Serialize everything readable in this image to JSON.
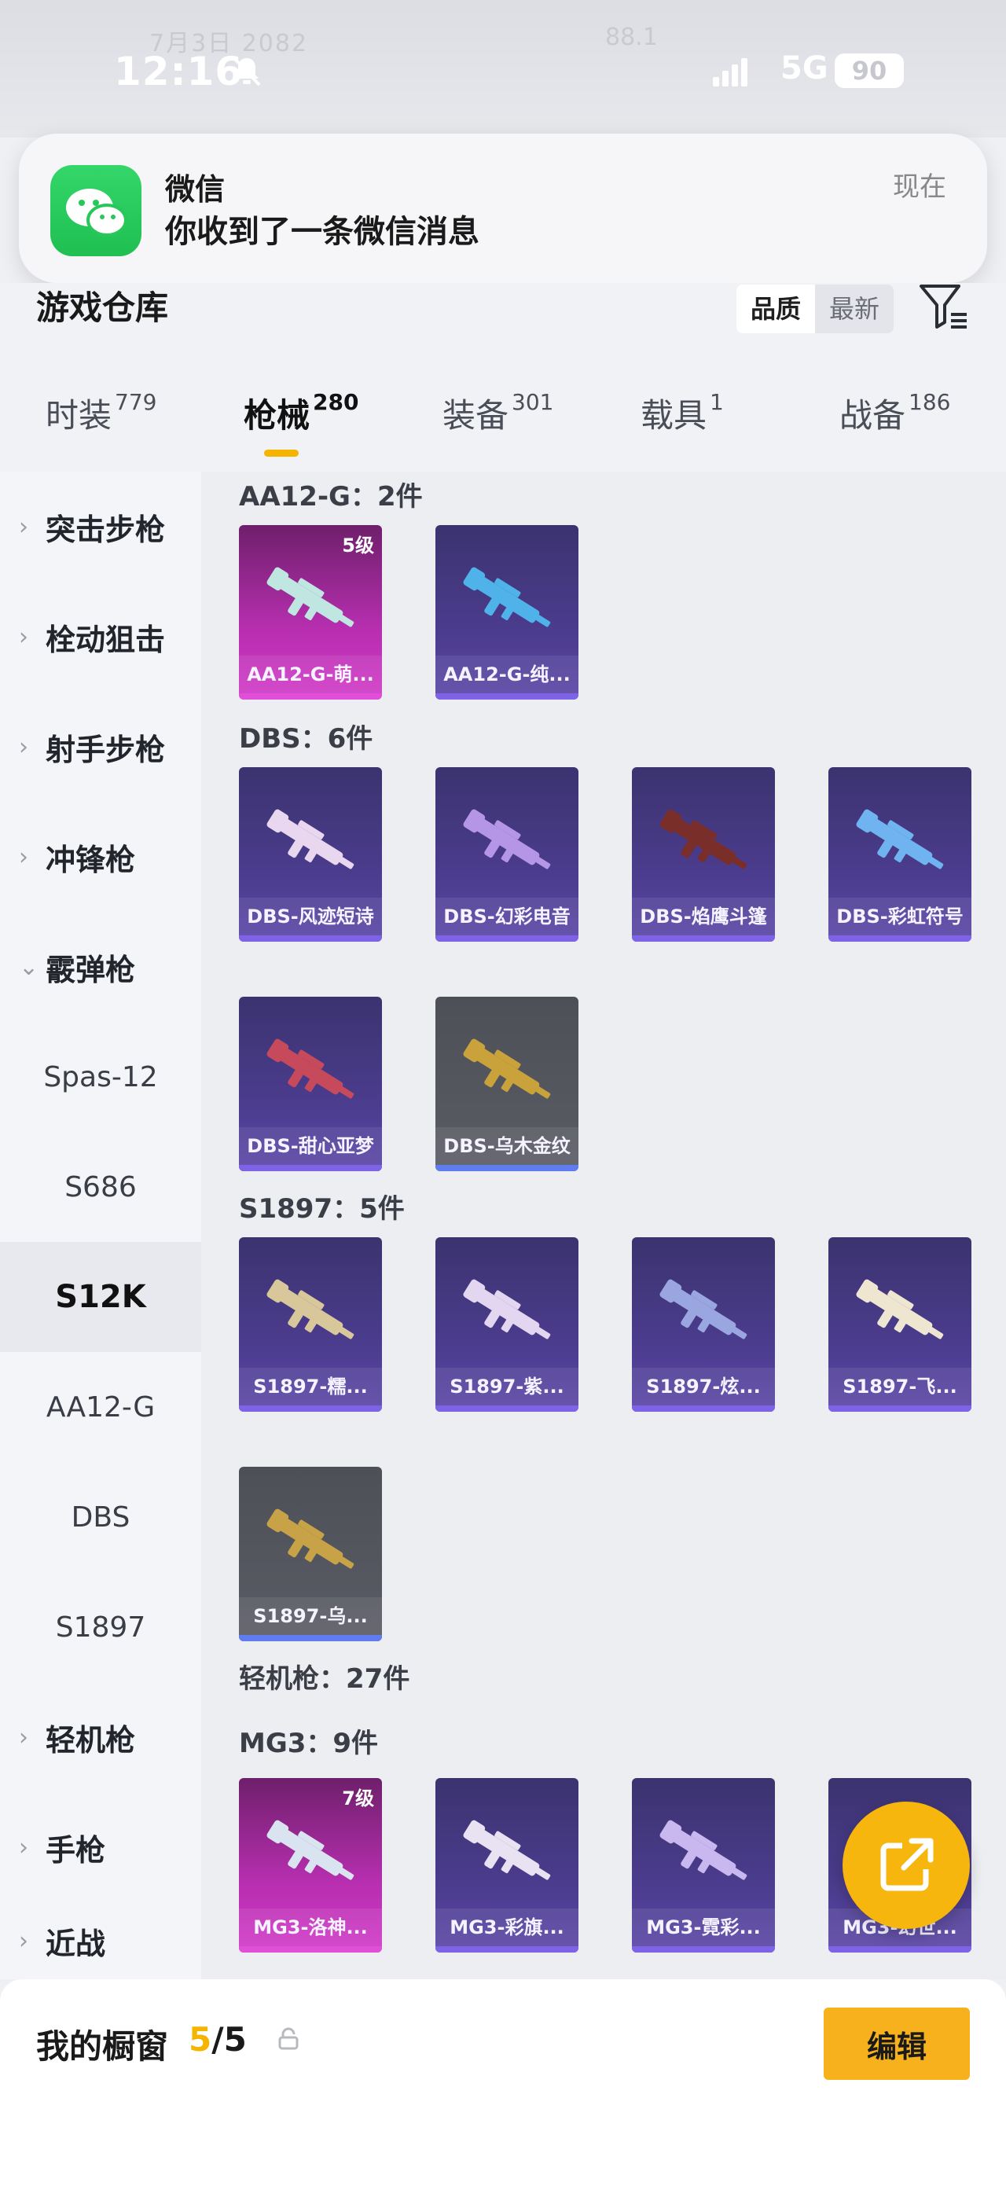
{
  "status_bar": {
    "time": "12:16",
    "network": "5G",
    "battery": "90",
    "faded_left": "7月3日  2082",
    "faded_right": "88.1"
  },
  "notification": {
    "app": "微信",
    "message": "你收到了一条微信消息",
    "time": "现在"
  },
  "header": {
    "title": "游戏仓库",
    "sort_quality": "品质",
    "sort_new": "最新"
  },
  "tabs": [
    {
      "label": "时装",
      "count": "779"
    },
    {
      "label": "枪械",
      "count": "280",
      "active": true
    },
    {
      "label": "装备",
      "count": "301"
    },
    {
      "label": "载具",
      "count": "1"
    },
    {
      "label": "战备",
      "count": "186"
    }
  ],
  "sidebar": [
    {
      "label": "突击步枪",
      "type": "category"
    },
    {
      "label": "栓动狙击",
      "type": "category"
    },
    {
      "label": "射手步枪",
      "type": "category"
    },
    {
      "label": "冲锋枪",
      "type": "category"
    },
    {
      "label": "霰弹枪",
      "type": "category",
      "expanded": true
    },
    {
      "label": "Spas-12",
      "type": "sub"
    },
    {
      "label": "S686",
      "type": "sub"
    },
    {
      "label": "S12K",
      "type": "sub",
      "selected": true
    },
    {
      "label": "AA12-G",
      "type": "sub"
    },
    {
      "label": "DBS",
      "type": "sub"
    },
    {
      "label": "S1897",
      "type": "sub"
    },
    {
      "label": "轻机枪",
      "type": "category"
    },
    {
      "label": "手枪",
      "type": "category"
    },
    {
      "label": "近战",
      "type": "category"
    }
  ],
  "groups": {
    "aa12": {
      "label": "AA12-G：2件",
      "items": [
        {
          "name": "AA12-G-萌...",
          "rarity": "pink",
          "level": "5级",
          "color": "#bfe6e0"
        },
        {
          "name": "AA12-G-纯...",
          "rarity": "purple",
          "color": "#4fb2e8"
        }
      ]
    },
    "dbs": {
      "label": "DBS：6件",
      "items": [
        {
          "name": "DBS-风迹短诗",
          "rarity": "purple",
          "color": "#e8d7ee"
        },
        {
          "name": "DBS-幻彩电音",
          "rarity": "purple",
          "color": "#b596e6"
        },
        {
          "name": "DBS-焰鹰斗篷",
          "rarity": "purple",
          "color": "#7a2e2a"
        },
        {
          "name": "DBS-彩虹符号",
          "rarity": "purple",
          "color": "#6fb4f0"
        },
        {
          "name": "DBS-甜心亚梦",
          "rarity": "purple",
          "color": "#c64a5c"
        },
        {
          "name": "DBS-乌木金纹",
          "rarity": "gray",
          "color": "#c9a23c"
        }
      ]
    },
    "s1897": {
      "label": "S1897：5件",
      "items": [
        {
          "name": "S1897-糯...",
          "rarity": "purple",
          "color": "#d8c79a"
        },
        {
          "name": "S1897-紫...",
          "rarity": "purple",
          "color": "#e3d6f0"
        },
        {
          "name": "S1897-炫...",
          "rarity": "purple",
          "color": "#9aa6e0"
        },
        {
          "name": "S1897-飞...",
          "rarity": "purple",
          "color": "#efe6d2"
        },
        {
          "name": "S1897-乌...",
          "rarity": "gray",
          "color": "#c7a246"
        }
      ]
    },
    "lmg": {
      "label": "轻机枪：27件"
    },
    "mg3": {
      "label": "MG3：9件",
      "items": [
        {
          "name": "MG3-洛神...",
          "rarity": "pink",
          "level": "7级",
          "color": "#d9e4f0"
        },
        {
          "name": "MG3-彩旗...",
          "rarity": "purple",
          "color": "#e8e2f2"
        },
        {
          "name": "MG3-霓彩...",
          "rarity": "purple",
          "color": "#c9b8ef"
        },
        {
          "name": "MG3-幻世...",
          "rarity": "purple",
          "color": "#e2c8e6"
        }
      ]
    }
  },
  "showcase": {
    "label": "我的橱窗",
    "current": "5",
    "total": "/5",
    "edit_label": "编辑"
  }
}
